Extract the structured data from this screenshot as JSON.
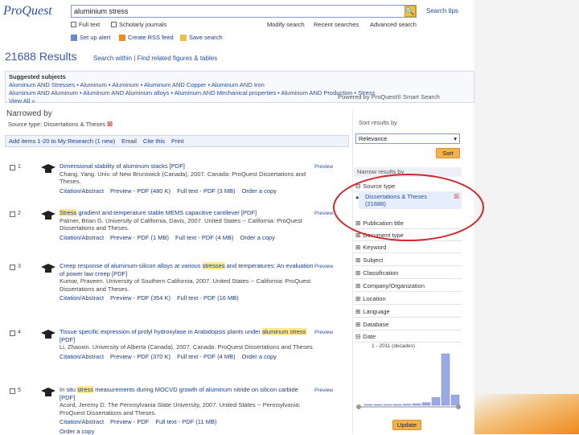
{
  "logo": {
    "text": "ProQuest"
  },
  "search": {
    "query": "aluminium stress",
    "tips": "Search tips"
  },
  "search_options": {
    "full_text": "Full text",
    "scholarly": "Scholarly journals",
    "modify": "Modify search",
    "recent": "Recent searches",
    "advanced": "Advanced search"
  },
  "actions": {
    "set_alert": "Set up alert",
    "rss": "Create RSS feed",
    "save": "Save search"
  },
  "results": {
    "count": "21688 Results",
    "search_within": "Search within",
    "find_related": "Find related figures & tables"
  },
  "suggested": {
    "label": "Suggested subjects",
    "items": [
      "Aluminum AND Stresses",
      "Aluminum",
      "Aluminum",
      "Aluminum AND Copper",
      "Aluminum AND Iron",
      "Aluminum AND Aluminum",
      "Aluminum AND Aluminum alloys",
      "Aluminum AND Mechanical properties",
      "Aluminum AND Production",
      "Stress"
    ],
    "view_all": "View All »"
  },
  "powered_by": "Powered by ProQuest® Smart Search",
  "narrowed": {
    "title": "Narrowed by",
    "source_type": "Source type: Dissertations & Theses"
  },
  "toolbar": {
    "add": "Add items 1-20 to My Research (1 new)",
    "email": "Email",
    "cite": "Cite this",
    "print": "Print"
  },
  "records": [
    {
      "num": "1",
      "title_pre": "Dimensional stability of aluminum stacks",
      "title_hl": "",
      "title_post": " [PDF]",
      "meta": "Chang, Yang. Univ. of New Brunswick (Canada), 2007. Canada: ProQuest Dissertations and Theses.",
      "links": [
        "Citation/Abstract",
        "Preview - PDF (480 K)",
        "Full text - PDF (3 MB)",
        "Order a copy"
      ],
      "preview": "Preview"
    },
    {
      "num": "2",
      "title_pre": "",
      "title_hl": "Stress",
      "title_post": " gradient and temperature stable MEMS capacitive cantilever [PDF]",
      "meta": "Palmer, Brian G. University of California, Davis, 2007. United States -- California: ProQuest Dissertations and Theses.",
      "links": [
        "Citation/Abstract",
        "Preview - PDF (1 MB)",
        "Full text - PDF (4 MB)",
        "Order a copy"
      ],
      "preview": "Preview"
    },
    {
      "num": "3",
      "title_pre": "Creep response of aluminum-silicon alloys at various ",
      "title_hl": "stresses",
      "title_post": " and temperatures: An evaluation of power law creep [PDF]",
      "meta": "Kumar, Praveen. University of Southern California, 2007. United States -- California: ProQuest Dissertations and Theses.",
      "links": [
        "Citation/Abstract",
        "Preview - PDF (354 K)",
        "Full text - PDF (16 MB)"
      ],
      "preview": "Preview"
    },
    {
      "num": "4",
      "title_pre": "Tissue specific expression of prolyl hydroxylase in Arabidopsis plants under ",
      "title_hl": "aluminum stress",
      "title_post": " [PDF]",
      "meta": "Li, Zhaoxin. University of Alberta (Canada), 2007. Canada: ProQuest Dissertations and Theses.",
      "links": [
        "Citation/Abstract",
        "Preview - PDF (370 K)",
        "Full text - PDF (4 MB)",
        "Order a copy"
      ],
      "preview": "Preview"
    },
    {
      "num": "5",
      "title_pre": "In situ ",
      "title_hl": "stress",
      "title_post": " measurements during MOCVD growth of aluminum nitride on silicon carbide [PDF]",
      "meta": "Acord, Jeremy D. The Pennsylvania State University, 2007. United States -- Pennsylvania: ProQuest Dissertations and Theses.",
      "links": [
        "Citation/Abstract",
        "Preview - PDF",
        "Full text - PDF (11 MB)"
      ],
      "extra": "Order a copy",
      "preview": "Preview"
    }
  ],
  "sidebar": {
    "sort_label": "Sort results by",
    "sort_value": "Relevance",
    "sort_button": "Sort",
    "narrow_label": "Narrow results by",
    "source_type": "Source type",
    "active_facet": "Dissertations & Theses",
    "active_count": "(21688)",
    "facets": [
      "Publication title",
      "Document type",
      "Keyword",
      "Subject",
      "Classification",
      "Company/Organization",
      "Location",
      "Language",
      "Database",
      "Date"
    ],
    "date_range": "1 - 2011 (decades)",
    "update_button": "Update"
  },
  "chart_data": {
    "type": "bar",
    "categories": [
      "1",
      "2",
      "3",
      "4",
      "5",
      "6",
      "7",
      "8",
      "9",
      "10"
    ],
    "values": [
      1,
      1,
      1,
      1,
      2,
      3,
      5,
      15,
      100,
      20
    ],
    "xlabel": "",
    "ylabel": ""
  },
  "colors": {
    "accent": "#2b4fa0",
    "highlight": "#ffe98a",
    "orange": "#f6b24a",
    "callout": "#d8232a"
  }
}
